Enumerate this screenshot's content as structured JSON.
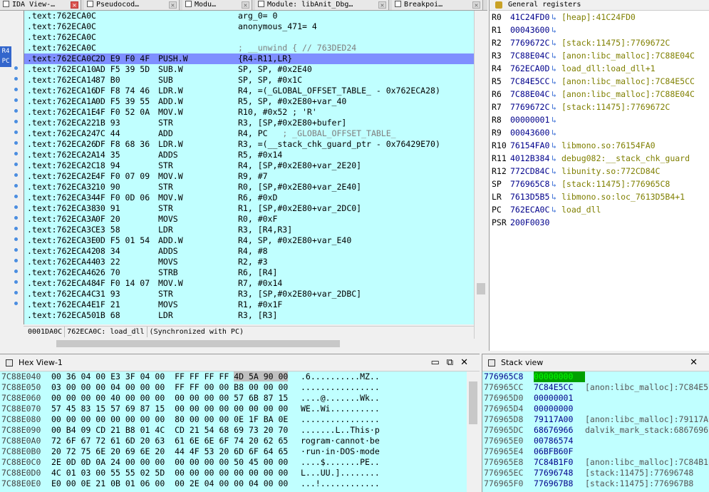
{
  "tabs": [
    {
      "label": "IDA View-…",
      "active": true
    },
    {
      "label": "Pseudocod…",
      "active": false
    },
    {
      "label": "Modu…",
      "active": false
    },
    {
      "label": "Module: libAnit_Dbg…",
      "active": false
    },
    {
      "label": "Breakpoi…",
      "active": false
    }
  ],
  "gutter": {
    "pc_label": "R4\nPC"
  },
  "disasm": {
    "lines": [
      {
        "addr": ".text:762ECA0C",
        "bytes": "",
        "mnem": "",
        "operand": "arg_0= 0",
        "comment": ""
      },
      {
        "addr": ".text:762ECA0C",
        "bytes": "",
        "mnem": "",
        "operand": "anonymous_471= 4",
        "comment": ""
      },
      {
        "addr": ".text:762ECA0C",
        "bytes": "",
        "mnem": "",
        "operand": "",
        "comment": ""
      },
      {
        "addr": ".text:762ECA0C",
        "bytes": "",
        "mnem": "",
        "operand": "; __unwind { // 763DED24",
        "comment": ""
      },
      {
        "addr": ".text:762ECA0C",
        "bytes": "2D E9 F0 4F",
        "mnem": "PUSH.W",
        "operand": "{R4-R11,LR}",
        "comment": "",
        "current": true
      },
      {
        "addr": ".text:762ECA10",
        "bytes": "AD F5 39 5D",
        "mnem": "SUB.W",
        "operand": "SP, SP, #0x2E40",
        "comment": ""
      },
      {
        "addr": ".text:762ECA14",
        "bytes": "87 B0",
        "mnem": "SUB",
        "operand": "SP, SP, #0x1C",
        "comment": ""
      },
      {
        "addr": ".text:762ECA16",
        "bytes": "DF F8 74 46",
        "mnem": "LDR.W",
        "operand": "R4, =(_GLOBAL_OFFSET_TABLE_ - 0x762ECA28)",
        "comment": ""
      },
      {
        "addr": ".text:762ECA1A",
        "bytes": "0D F5 39 55",
        "mnem": "ADD.W",
        "operand": "R5, SP, #0x2E80+var_40",
        "comment": ""
      },
      {
        "addr": ".text:762ECA1E",
        "bytes": "4F F0 52 0A",
        "mnem": "MOV.W",
        "operand": "R10, #0x52 ; 'R'",
        "comment": ""
      },
      {
        "addr": ".text:762ECA22",
        "bytes": "1B 93",
        "mnem": "STR",
        "operand": "R3, [SP,#0x2E80+bufer]",
        "comment": ""
      },
      {
        "addr": ".text:762ECA24",
        "bytes": "7C 44",
        "mnem": "ADD",
        "operand": "R4, PC",
        "comment": "; _GLOBAL_OFFSET_TABLE_"
      },
      {
        "addr": ".text:762ECA26",
        "bytes": "DF F8 68 36",
        "mnem": "LDR.W",
        "operand": "R3, =(__stack_chk_guard_ptr - 0x76429E70)",
        "comment": ""
      },
      {
        "addr": ".text:762ECA2A",
        "bytes": "14 35",
        "mnem": "ADDS",
        "operand": "R5, #0x14",
        "comment": ""
      },
      {
        "addr": ".text:762ECA2C",
        "bytes": "18 94",
        "mnem": "STR",
        "operand": "R4, [SP,#0x2E80+var_2E20]",
        "comment": ""
      },
      {
        "addr": ".text:762ECA2E",
        "bytes": "4F F0 07 09",
        "mnem": "MOV.W",
        "operand": "R9, #7",
        "comment": ""
      },
      {
        "addr": ".text:762ECA32",
        "bytes": "10 90",
        "mnem": "STR",
        "operand": "R0, [SP,#0x2E80+var_2E40]",
        "comment": ""
      },
      {
        "addr": ".text:762ECA34",
        "bytes": "4F F0 0D 06",
        "mnem": "MOV.W",
        "operand": "R6, #0xD",
        "comment": ""
      },
      {
        "addr": ".text:762ECA38",
        "bytes": "30 91",
        "mnem": "STR",
        "operand": "R1, [SP,#0x2E80+var_2DC0]",
        "comment": ""
      },
      {
        "addr": ".text:762ECA3A",
        "bytes": "0F 20",
        "mnem": "MOVS",
        "operand": "R0, #0xF",
        "comment": ""
      },
      {
        "addr": ".text:762ECA3C",
        "bytes": "E3 58",
        "mnem": "LDR",
        "operand": "R3, [R4,R3]",
        "comment": ""
      },
      {
        "addr": ".text:762ECA3E",
        "bytes": "0D F5 01 54",
        "mnem": "ADD.W",
        "operand": "R4, SP, #0x2E80+var_E40",
        "comment": ""
      },
      {
        "addr": ".text:762ECA42",
        "bytes": "08 34",
        "mnem": "ADDS",
        "operand": "R4, #8",
        "comment": ""
      },
      {
        "addr": ".text:762ECA44",
        "bytes": "03 22",
        "mnem": "MOVS",
        "operand": "R2, #3",
        "comment": ""
      },
      {
        "addr": ".text:762ECA46",
        "bytes": "26 70",
        "mnem": "STRB",
        "operand": "R6, [R4]",
        "comment": ""
      },
      {
        "addr": ".text:762ECA48",
        "bytes": "4F F0 14 07",
        "mnem": "MOV.W",
        "operand": "R7, #0x14",
        "comment": ""
      },
      {
        "addr": ".text:762ECA4C",
        "bytes": "31 93",
        "mnem": "STR",
        "operand": "R3, [SP,#0x2E80+var_2DBC]",
        "comment": ""
      },
      {
        "addr": ".text:762ECA4E",
        "bytes": "1F 21",
        "mnem": "MOVS",
        "operand": "R1, #0x1F",
        "comment": ""
      },
      {
        "addr": ".text:762ECA50",
        "bytes": "1B 68",
        "mnem": "LDR",
        "operand": "R3, [R3]",
        "comment": ""
      }
    ]
  },
  "status": {
    "offset": "0001DA0C",
    "location": "762ECA0C: load_dll",
    "sync": "(Synchronized with PC)"
  },
  "registers": {
    "title": "General registers",
    "rows": [
      {
        "name": "R0",
        "value": "41C24FD0",
        "arrow": "↳",
        "desc": "[heap]:41C24FD0"
      },
      {
        "name": "R1",
        "value": "00043600",
        "arrow": "↳",
        "desc": ""
      },
      {
        "name": "R2",
        "value": "7769672C",
        "arrow": "↳",
        "desc": "[stack:11475]:7769672C"
      },
      {
        "name": "R3",
        "value": "7C88E04C",
        "arrow": "↳",
        "desc": "[anon:libc_malloc]:7C88E04C"
      },
      {
        "name": "R4",
        "value": "762ECA0D",
        "arrow": "↳",
        "desc": "load_dll:load_dll+1"
      },
      {
        "name": "R5",
        "value": "7C84E5CC",
        "arrow": "↳",
        "desc": "[anon:libc_malloc]:7C84E5CC"
      },
      {
        "name": "R6",
        "value": "7C88E04C",
        "arrow": "↳",
        "desc": "[anon:libc_malloc]:7C88E04C"
      },
      {
        "name": "R7",
        "value": "7769672C",
        "arrow": "↳",
        "desc": "[stack:11475]:7769672C"
      },
      {
        "name": "R8",
        "value": "00000001",
        "arrow": "↳",
        "desc": ""
      },
      {
        "name": "R9",
        "value": "00043600",
        "arrow": "↳",
        "desc": ""
      },
      {
        "name": "R10",
        "value": "76154FA0",
        "arrow": "↳",
        "desc": "libmono.so:76154FA0"
      },
      {
        "name": "R11",
        "value": "4012B384",
        "arrow": "↳",
        "desc": "debug082:__stack_chk_guard"
      },
      {
        "name": "R12",
        "value": "772CD84C",
        "arrow": "↳",
        "desc": "libunity.so:772CD84C"
      },
      {
        "name": "SP",
        "value": "776965C8",
        "arrow": "↳",
        "desc": "[stack:11475]:776965C8"
      },
      {
        "name": "LR",
        "value": "7613D5B5",
        "arrow": "↳",
        "desc": "libmono.so:loc_7613D5B4+1"
      },
      {
        "name": "PC",
        "value": "762ECA0C",
        "arrow": "↳",
        "desc": "load_dll"
      },
      {
        "name": "PSR",
        "value": "200F0030",
        "arrow": "",
        "desc": ""
      }
    ]
  },
  "hexview": {
    "title": "Hex View-1",
    "rows": [
      {
        "addr": "7C88E040",
        "bytes": "00 36 04 00 E3 3F 04 00  FF FF FF FF",
        "hl": "4D 5A 90 00",
        "ascii": ".6..........MZ.."
      },
      {
        "addr": "7C88E050",
        "bytes": "03 00 00 00 04 00 00 00  FF FF 00 00 B8 00 00 00",
        "hl": "",
        "ascii": "................"
      },
      {
        "addr": "7C88E060",
        "bytes": "00 00 00 00 40 00 00 00  00 00 00 00 57 6B 87 15",
        "hl": "",
        "ascii": "....@.......Wk.."
      },
      {
        "addr": "7C88E070",
        "bytes": "57 45 83 15 57 69 87 15  00 00 00 00 00 00 00 00",
        "hl": "",
        "ascii": "WE..Wi.........."
      },
      {
        "addr": "7C88E080",
        "bytes": "00 00 00 00 00 00 00 00  80 00 00 00 0E 1F BA 0E",
        "hl": "",
        "ascii": "................"
      },
      {
        "addr": "7C88E090",
        "bytes": "00 B4 09 CD 21 B8 01 4C  CD 21 54 68 69 73 20 70",
        "hl": "",
        "ascii": ".......L..This·p"
      },
      {
        "addr": "7C88E0A0",
        "bytes": "72 6F 67 72 61 6D 20 63  61 6E 6E 6F 74 20 62 65",
        "hl": "",
        "ascii": "rogram·cannot·be"
      },
      {
        "addr": "7C88E0B0",
        "bytes": "20 72 75 6E 20 69 6E 20  44 4F 53 20 6D 6F 64 65",
        "hl": "",
        "ascii": "·run·in·DOS·mode"
      },
      {
        "addr": "7C88E0C0",
        "bytes": "2E 0D 0D 0A 24 00 00 00  00 00 00 00 50 45 00 00",
        "hl": "",
        "ascii": "....$.......PE.."
      },
      {
        "addr": "7C88E0D0",
        "bytes": "4C 01 03 00 55 55 02 5D  00 00 00 00 00 00 00 00",
        "hl": "",
        "ascii": "L...UU.]........"
      },
      {
        "addr": "7C88E0E0",
        "bytes": "E0 00 0E 21 0B 01 06 00  00 2E 04 00 00 04 00 00",
        "hl": "",
        "ascii": "...!............"
      }
    ]
  },
  "stackview": {
    "title": "Stack view",
    "rows": [
      {
        "addr": "776965C8",
        "value": "00000000",
        "desc": ""
      },
      {
        "addr": "776965CC",
        "value": "7C84E5CC",
        "desc": "[anon:libc_malloc]:7C84E5C"
      },
      {
        "addr": "776965D0",
        "value": "00000001",
        "desc": ""
      },
      {
        "addr": "776965D4",
        "value": "00000000",
        "desc": ""
      },
      {
        "addr": "776965D8",
        "value": "79117A00",
        "desc": "[anon:libc_malloc]:79117A0"
      },
      {
        "addr": "776965DC",
        "value": "68676966",
        "desc": "dalvik_mark_stack:6867696"
      },
      {
        "addr": "776965E0",
        "value": "00786574",
        "desc": ""
      },
      {
        "addr": "776965E4",
        "value": "06BFB60F",
        "desc": ""
      },
      {
        "addr": "776965E8",
        "value": "7C84B1F0",
        "desc": "[anon:libc_malloc]:7C84B1"
      },
      {
        "addr": "776965EC",
        "value": "77696748",
        "desc": "[stack:11475]:77696748"
      },
      {
        "addr": "776965F0",
        "value": "776967B8",
        "desc": "[stack:11475]:776967B8"
      }
    ]
  },
  "colors": {
    "code_bg": "#c0ffff",
    "current_line": "#7f8fff",
    "pc_marker": "#3366cc"
  }
}
